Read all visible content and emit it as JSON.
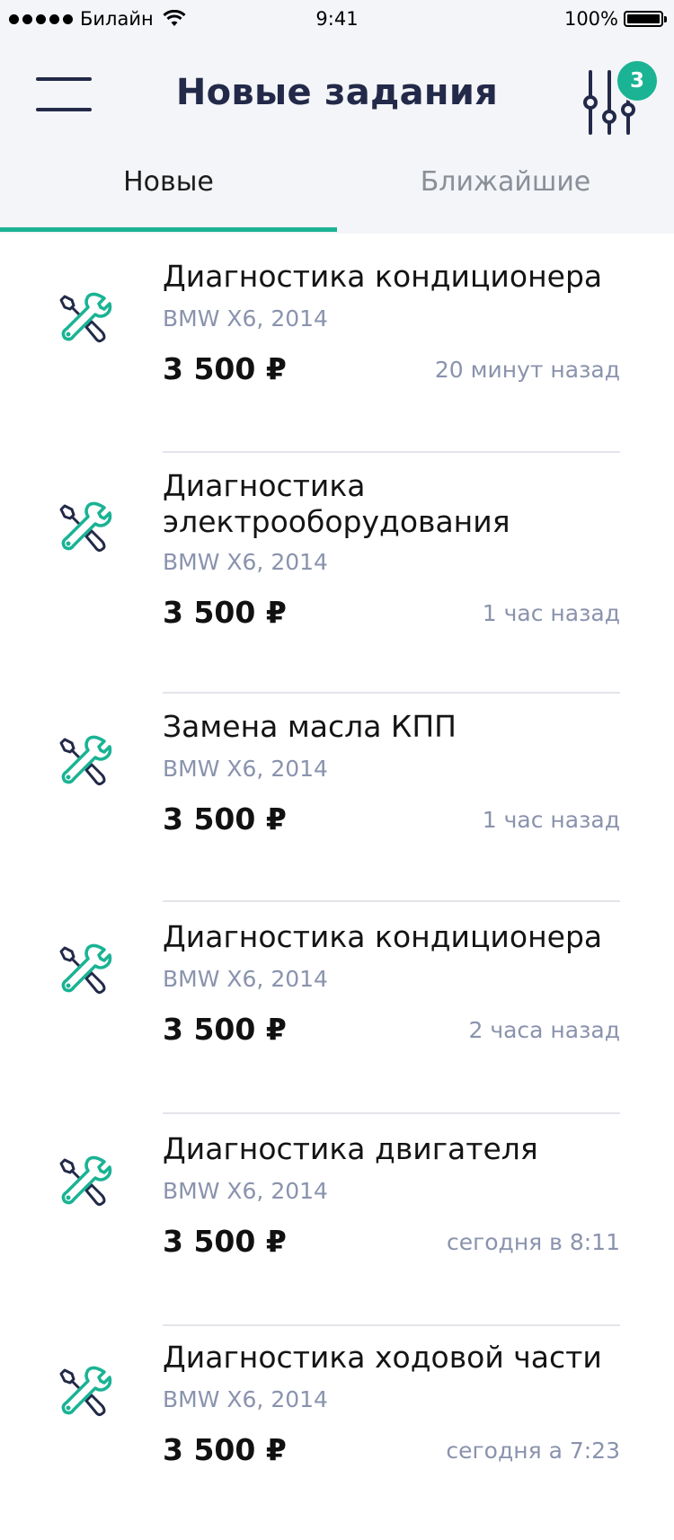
{
  "status_bar": {
    "carrier": "Билайн",
    "time": "9:41",
    "battery": "100%"
  },
  "header": {
    "title": "Новые задания",
    "filter_badge": "3"
  },
  "tabs": [
    {
      "label": "Новые",
      "active": true
    },
    {
      "label": "Ближайшие",
      "active": false
    }
  ],
  "colors": {
    "accent": "#1ab394",
    "title": "#232948",
    "muted": "#8a93ad",
    "header_bg": "#f3f5f8"
  },
  "tasks": [
    {
      "icon": "wrench-screwdriver-icon",
      "title": "Диагностика кондиционера",
      "car": "BMW X6, 2014",
      "price": "3 500 ₽",
      "time": "20 минут назад"
    },
    {
      "icon": "wrench-screwdriver-icon",
      "title": "Диагностика электрооборудования",
      "car": "BMW X6, 2014",
      "price": "3 500 ₽",
      "time": "1 час назад"
    },
    {
      "icon": "wrench-screwdriver-icon",
      "title": "Замена масла КПП",
      "car": "BMW X6, 2014",
      "price": "3 500 ₽",
      "time": "1 час назад"
    },
    {
      "icon": "wrench-screwdriver-icon",
      "title": "Диагностика кондиционера",
      "car": "BMW X6, 2014",
      "price": "3 500 ₽",
      "time": "2 часа назад"
    },
    {
      "icon": "wrench-screwdriver-icon",
      "title": "Диагностика двигателя",
      "car": "BMW X6, 2014",
      "price": "3 500 ₽",
      "time": "сегодня в 8:11"
    },
    {
      "icon": "wrench-screwdriver-icon",
      "title": "Диагностика ходовой части",
      "car": "BMW X6, 2014",
      "price": "3 500 ₽",
      "time": "сегодня а 7:23"
    }
  ]
}
